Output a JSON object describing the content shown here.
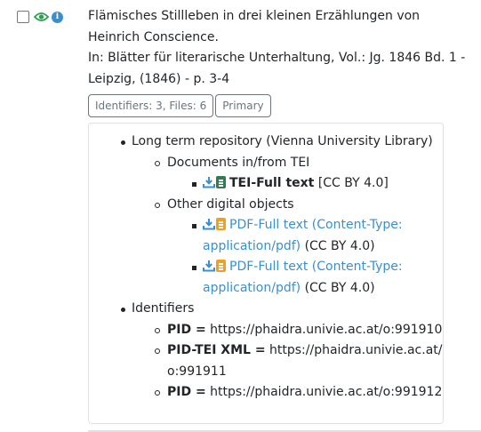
{
  "record": {
    "title_line1": "Flämisches Stillleben in drei kleinen Erzählungen von",
    "title_line2": "Heinrich Conscience.",
    "source_line1": "In: Blätter für literarische Unterhaltung, Vol.: Jg. 1846 Bd. 1 -",
    "source_line2": "Leipzig, (1846) - p. 3-4"
  },
  "buttons": {
    "identifiers_label": "Identifiers: 3, Files: 6",
    "primary_label": "Primary"
  },
  "tree": {
    "repository": "Long term repository (Vienna University Library)",
    "tei_group": "Documents in/from TEI",
    "tei_file": {
      "name": "TEI-Full text",
      "license": "[CC BY 4.0]"
    },
    "other_group": "Other digital objects",
    "pdf_files": [
      {
        "line1": "PDF-Full text (Content-Type:",
        "line2": "application/pdf)",
        "license": "(CC BY 4.0)"
      },
      {
        "line1": "PDF-Full text (Content-Type:",
        "line2": "application/pdf)",
        "license": "(CC BY 4.0)"
      }
    ],
    "identifiers_heading": "Identifiers",
    "identifiers": [
      {
        "label": "PID =",
        "value": "https://phaidra.univie.ac.at/o:991910"
      },
      {
        "label": "PID-TEI XML =",
        "value_line1": "https://phaidra.univie.ac.at/",
        "value_line2": "o:991911"
      },
      {
        "label": "PID =",
        "value": "https://phaidra.univie.ac.at/o:991912"
      }
    ]
  },
  "icons": {
    "eye": "eye-icon",
    "info": "info-icon",
    "download": "download-icon",
    "tei_doc": "document-icon",
    "pdf_doc": "pdf-document-icon"
  },
  "colors": {
    "eye": "#2e9e4f",
    "info": "#3a8fd0",
    "link": "#3a8fd0",
    "tei_doc": "#2e7d4f",
    "pdf_doc": "#f0a020",
    "download": "#3a8fd0"
  },
  "info_glyph": "i"
}
